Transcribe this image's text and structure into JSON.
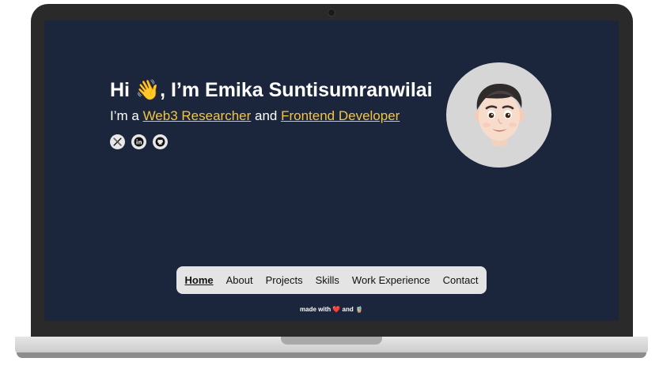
{
  "hero": {
    "greeting": "Hi 👋, I’m Emika Suntisumranwilai",
    "sub_prefix": "I’m a ",
    "role_1": "Web3 Researcher",
    "sub_mid": " and ",
    "role_2": "Frontend Developer",
    "accent_color": "#f4c541",
    "socials": [
      {
        "icon": "x-twitter-icon"
      },
      {
        "icon": "linkedin-icon"
      },
      {
        "icon": "github-icon"
      }
    ]
  },
  "avatar": {
    "icon": "memoji-avatar"
  },
  "nav": {
    "items": [
      {
        "label": "Home",
        "active": true
      },
      {
        "label": "About"
      },
      {
        "label": "Projects"
      },
      {
        "label": "Skills"
      },
      {
        "label": "Work Experience"
      },
      {
        "label": "Contact"
      }
    ]
  },
  "footer": {
    "prefix": "made with ",
    "heart": "❤️",
    "mid": " and ",
    "coffee": "🧋"
  },
  "colors": {
    "screen_bg": "#1b253b",
    "nav_bg": "#e4e4e4"
  }
}
